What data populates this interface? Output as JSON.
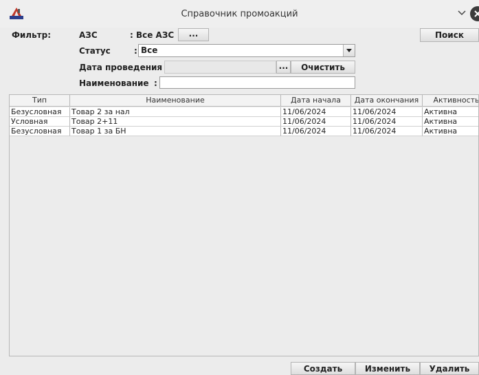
{
  "window": {
    "title": "Справочник промоакций"
  },
  "filter": {
    "label": "Фильтр:",
    "azs_label": "АЗС",
    "azs_value": ": Все АЗС",
    "azs_button": "...",
    "status_label": "Статус",
    "status_colon": ":",
    "status_value": "Все",
    "date_label": "Дата проведения :",
    "date_value": "",
    "date_button": "...",
    "clear_button": "Очистить",
    "name_label": "Наименование",
    "name_colon": ":",
    "name_value": "",
    "search_button": "Поиск"
  },
  "table": {
    "columns": [
      "Тип",
      "Наименование",
      "Дата начала",
      "Дата окончания",
      "Активность"
    ],
    "rows": [
      [
        "Безусловная",
        "Товар 2 за нал",
        "11/06/2024",
        "11/06/2024",
        "Активна"
      ],
      [
        "Условная",
        "Товар 2+11",
        "11/06/2024",
        "11/06/2024",
        "Активна"
      ],
      [
        "Безусловная",
        "Товар 1 за БН",
        "11/06/2024",
        "11/06/2024",
        "Активна"
      ]
    ]
  },
  "actions": {
    "create": "Создать",
    "edit": "Изменить",
    "delete": "Удалить"
  },
  "icons": {
    "app": "app-logo-icon",
    "chevron": "chevron-down-icon",
    "close": "close-icon"
  }
}
